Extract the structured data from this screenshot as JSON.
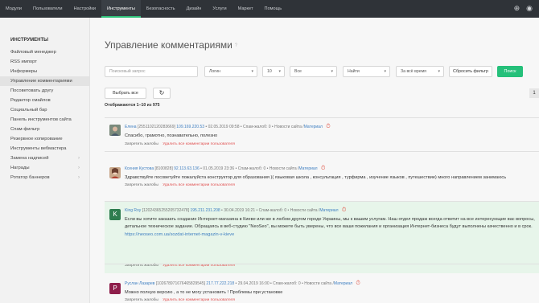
{
  "nav": {
    "items": [
      "Модули",
      "Пользователи",
      "Настройки",
      "Инструменты",
      "Безопасность",
      "Дизайн",
      "Услуги",
      "Маркет",
      "Помощь"
    ],
    "active_index": 3
  },
  "sidebar": {
    "title": "ИНСТРУМЕНТЫ",
    "items": [
      {
        "label": "Файловый менеджер"
      },
      {
        "label": "RSS импорт"
      },
      {
        "label": "Информеры"
      },
      {
        "label": "Управление комментариями"
      },
      {
        "label": "Посоветовать другу"
      },
      {
        "label": "Редактор смайлов"
      },
      {
        "label": "Социальный бар"
      },
      {
        "label": "Панель инструментов сайта"
      },
      {
        "label": "Спам-фильтр"
      },
      {
        "label": "Резервное копирование"
      },
      {
        "label": "Инструменты вебмастера"
      },
      {
        "label": "Замена надписей"
      },
      {
        "label": "Награды"
      },
      {
        "label": "Ротатор баннеров"
      }
    ],
    "active_index": 3
  },
  "page": {
    "title": "Управление комментариями",
    "help": "?"
  },
  "filters": {
    "search_placeholder": "Поисковый запрос",
    "login": "Логин",
    "per_page": "10",
    "scope": "Все",
    "action": "Найти",
    "period": "За всё время",
    "reset": "Сбросить фильтр",
    "search": "Поиск"
  },
  "toolbar": {
    "select_all": "Выбрать все",
    "refresh_icon": "↻",
    "shown": "Отображаются 1–10 из 975",
    "page": "1"
  },
  "comments": [
    {
      "author": "Елена",
      "id": "[2551102120283669]",
      "ip": "109.169.220.53",
      "date": "02.05.2019 09:58",
      "spam": "Спам-жалоб: 0",
      "section": "Новости сайта /",
      "link": "Материал",
      "text": "Спасибо, грамотно, познавательно, полезно",
      "actions": {
        "ban": "Запретить жалобы",
        "delete": "Удалить все комментарии пользователя"
      }
    },
    {
      "author": "Ксения Кустова",
      "id": "[8100828]",
      "ip": "92.113.63.136",
      "date": "01.05.2019 23:36",
      "spam": "Спам-жалоб: 0",
      "section": "Новости сайта /",
      "link": "Материал",
      "text": "Здравствуйте посоветуйте пожалуйста конструктор для образования )( языковая школа , консультация , турфирма , изучение языков , путешествие) много направлением занимаюсь",
      "actions": {
        "ban": "Запретить жалобы",
        "delete": "Удалить все комментарии пользователя"
      }
    },
    {
      "author": "King Roy",
      "id": "[12024365255205732478]",
      "ip": "195.211.231.208",
      "date": "30.04.2019 16:21",
      "spam": "Спам-жалоб: 0",
      "section": "Новости сайта /",
      "link": "Материал",
      "text": "Если вы хотите заказать создание Интернет-магазина в Киеве или же в любом другом городе Украины, мы к вашим услугам. Наш отдел продаж всегда ответит на все интересующие вас вопросы, детальное техническое задание. Обращаясь в веб-студию \"NeoSeo\", вы можете быть уверены, что все ваши пожелания и организация Интернет-бизнеса будут выполнены качественно и в срок.",
      "url": "https://neoseo.com.ua/sozdat-internet-magazin-v-kieve",
      "actions": {
        "ban": "Запретить жалобы",
        "delete": "Удалить все комментарии пользователя"
      }
    },
    {
      "author": "Руслан Лазарев",
      "id": "[102678971676465829545]",
      "ip": "217.77.222.218",
      "date": "29.04.2019 16:00",
      "spam": "Спам-жалоб: 0",
      "section": "Новости сайта /",
      "link": "Материал",
      "text": "Можно полную версию , а то не могу установить ! Проблемы при установке",
      "actions": {
        "ban": "Запретить жалобы",
        "delete": "Удалить все комментарии пользователя"
      }
    }
  ],
  "colors": {
    "topbar": "#2f3338",
    "accent": "#25c07a",
    "link": "#3f7fc1",
    "delete": "#e05050",
    "highlight_row": "#e7f5ea"
  },
  "icons": {
    "help": "question-icon",
    "refresh": "refresh-icon",
    "clock": "clock-icon",
    "caret": "chevron-down-icon",
    "add": "plus-circle-icon",
    "user": "user-circle-icon"
  }
}
